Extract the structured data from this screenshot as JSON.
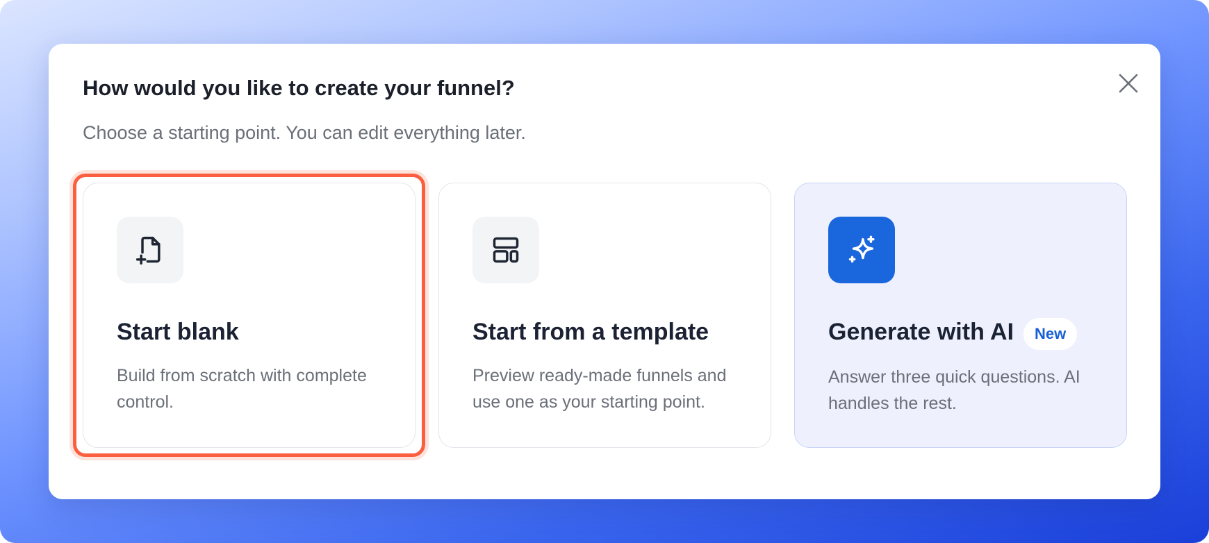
{
  "modal": {
    "title": "How would you like to create your funnel?",
    "subtitle": "Choose a starting point. You can edit everything later.",
    "close_icon": "close-icon"
  },
  "options": [
    {
      "icon": "file-plus-icon",
      "title": "Start blank",
      "description": "Build from scratch with complete control.",
      "highlighted": true
    },
    {
      "icon": "layout-template-icon",
      "title": "Start from a template",
      "description": "Preview ready-made funnels and use one as your starting point."
    },
    {
      "icon": "sparkles-icon",
      "title": "Generate with AI",
      "badge": "New",
      "description": "Answer three quick questions. AI handles the rest."
    }
  ],
  "colors": {
    "highlight": "#fb5f3f",
    "ai_accent": "#1a67dd",
    "ai_card_bg": "#eef1fd",
    "badge_text": "#1a5fd6"
  }
}
